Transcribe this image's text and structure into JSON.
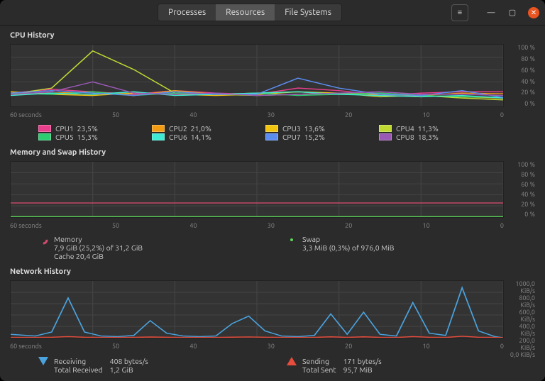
{
  "titlebar": {
    "tabs": [
      "Processes",
      "Resources",
      "File Systems"
    ],
    "active_tab": 1
  },
  "cpu": {
    "title": "CPU History",
    "yaxis_labels": [
      "100 %",
      "80 %",
      "60 %",
      "40 %",
      "20 %",
      "0 %"
    ],
    "xaxis_labels": [
      "60 seconds",
      "50",
      "40",
      "30",
      "20",
      "10",
      "0"
    ],
    "cores": [
      {
        "name": "CPU1",
        "pct": "23,5%",
        "color": "#e83e8c"
      },
      {
        "name": "CPU2",
        "pct": "21,0%",
        "color": "#f39c12"
      },
      {
        "name": "CPU3",
        "pct": "13,6%",
        "color": "#f1c40f"
      },
      {
        "name": "CPU4",
        "pct": "11,3%",
        "color": "#c0d932"
      },
      {
        "name": "CPU5",
        "pct": "15,3%",
        "color": "#2ecc71"
      },
      {
        "name": "CPU6",
        "pct": "14,1%",
        "color": "#3eead3"
      },
      {
        "name": "CPU7",
        "pct": "15,2%",
        "color": "#5b8def"
      },
      {
        "name": "CPU8",
        "pct": "18,3%",
        "color": "#9b59b6"
      }
    ]
  },
  "mem": {
    "title": "Memory and Swap History",
    "yaxis_labels": [
      "100 %",
      "80 %",
      "60 %",
      "40 %",
      "20 %",
      "0 %"
    ],
    "xaxis_labels": [
      "60 seconds",
      "50",
      "40",
      "30",
      "20",
      "10",
      "0"
    ],
    "memory": {
      "label": "Memory",
      "line1": "7,9 GiB (25,2%) of 31,2 GiB",
      "line2": "Cache 20,4 GiB",
      "color": "#d04a6b"
    },
    "swap": {
      "label": "Swap",
      "line1": "3,3 MiB (0,3%) of 976,0 MiB",
      "color": "#5bd65b"
    }
  },
  "net": {
    "title": "Network History",
    "yaxis_labels": [
      "1000,0 KiB/s",
      "800,0 KiB/s",
      "600,0 KiB/s",
      "400,0 KiB/s",
      "200,0 KiB/s",
      "0,0 KiB/s"
    ],
    "xaxis_labels": [
      "60 seconds",
      "50",
      "40",
      "30",
      "20",
      "10",
      "0"
    ],
    "recv": {
      "label": "Receiving",
      "rate": "408 bytes/s",
      "total_label": "Total Received",
      "total": "1,2 GiB"
    },
    "send": {
      "label": "Sending",
      "rate": "171 bytes/s",
      "total_label": "Total Sent",
      "total": "95,7 MiB"
    }
  },
  "chart_data": [
    {
      "type": "line",
      "title": "CPU History",
      "xlabel": "seconds",
      "ylabel": "%",
      "ylim": [
        0,
        100
      ],
      "xlim": [
        60,
        0
      ],
      "x": [
        60,
        55,
        50,
        45,
        40,
        35,
        30,
        25,
        20,
        15,
        10,
        5,
        0
      ],
      "series": [
        {
          "name": "CPU1",
          "color": "#e83e8c",
          "values": [
            22,
            28,
            24,
            20,
            26,
            22,
            20,
            30,
            26,
            18,
            22,
            24,
            24
          ]
        },
        {
          "name": "CPU2",
          "color": "#f39c12",
          "values": [
            20,
            22,
            24,
            18,
            26,
            20,
            22,
            24,
            20,
            22,
            18,
            22,
            21
          ]
        },
        {
          "name": "CPU3",
          "color": "#f1c40f",
          "values": [
            24,
            20,
            18,
            22,
            20,
            18,
            20,
            24,
            22,
            20,
            18,
            16,
            14
          ]
        },
        {
          "name": "CPU4",
          "color": "#c0d932",
          "values": [
            20,
            30,
            90,
            60,
            22,
            20,
            18,
            20,
            22,
            16,
            18,
            14,
            11
          ]
        },
        {
          "name": "CPU5",
          "color": "#2ecc71",
          "values": [
            22,
            20,
            24,
            18,
            22,
            20,
            22,
            18,
            20,
            22,
            18,
            16,
            15
          ]
        },
        {
          "name": "CPU6",
          "color": "#3eead3",
          "values": [
            18,
            22,
            20,
            24,
            18,
            20,
            22,
            24,
            20,
            18,
            16,
            18,
            14
          ]
        },
        {
          "name": "CPU7",
          "color": "#5b8def",
          "values": [
            22,
            26,
            22,
            18,
            24,
            20,
            20,
            46,
            30,
            20,
            18,
            26,
            15
          ]
        },
        {
          "name": "CPU8",
          "color": "#9b59b6",
          "values": [
            20,
            24,
            40,
            22,
            20,
            22,
            18,
            20,
            22,
            24,
            20,
            20,
            18
          ]
        }
      ]
    },
    {
      "type": "line",
      "title": "Memory and Swap History",
      "xlabel": "seconds",
      "ylabel": "%",
      "ylim": [
        0,
        100
      ],
      "xlim": [
        60,
        0
      ],
      "x": [
        60,
        0
      ],
      "series": [
        {
          "name": "Memory",
          "color": "#d04a6b",
          "values": [
            25.2,
            25.2
          ]
        },
        {
          "name": "Swap",
          "color": "#5bd65b",
          "values": [
            0.3,
            0.3
          ]
        }
      ]
    },
    {
      "type": "line",
      "title": "Network History",
      "xlabel": "seconds",
      "ylabel": "KiB/s",
      "ylim": [
        0,
        1000
      ],
      "xlim": [
        60,
        0
      ],
      "x": [
        60,
        57,
        55,
        53,
        51,
        49,
        47,
        45,
        43,
        41,
        39,
        37,
        35,
        33,
        31,
        29,
        27,
        25,
        23,
        21,
        19,
        17,
        15,
        13,
        11,
        9,
        7,
        5,
        3,
        1,
        0
      ],
      "series": [
        {
          "name": "Receiving",
          "color": "#4aa3df",
          "values": [
            60,
            30,
            100,
            700,
            100,
            30,
            20,
            40,
            300,
            80,
            30,
            20,
            30,
            250,
            380,
            120,
            30,
            20,
            40,
            420,
            60,
            450,
            60,
            30,
            620,
            80,
            40,
            880,
            120,
            20,
            0
          ]
        },
        {
          "name": "Sending",
          "color": "#e74c3c",
          "values": [
            5,
            5,
            8,
            20,
            8,
            5,
            5,
            6,
            12,
            8,
            5,
            5,
            5,
            10,
            14,
            8,
            5,
            5,
            6,
            16,
            6,
            16,
            6,
            5,
            20,
            8,
            5,
            26,
            8,
            5,
            0
          ]
        }
      ]
    }
  ]
}
